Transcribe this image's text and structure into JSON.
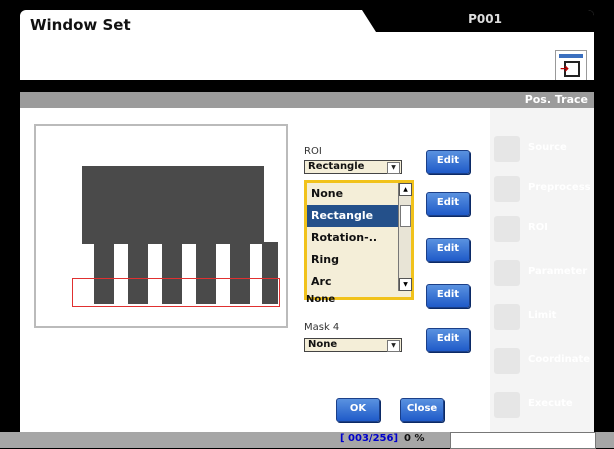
{
  "window": {
    "title": "Window Set",
    "tab": "P001"
  },
  "strip": {
    "label": "Pos. Trace"
  },
  "roi": {
    "label": "ROI",
    "selected": "Rectangle",
    "options": [
      "None",
      "Rectangle",
      "Rotation-..",
      "Ring",
      "Arc"
    ],
    "hidden_value": "None"
  },
  "mask4": {
    "label": "Mask 4",
    "selected": "None"
  },
  "buttons": {
    "edit": "Edit",
    "ok": "OK",
    "close": "Close"
  },
  "nav": {
    "items": [
      {
        "label": "Source",
        "icon": "camera-icon"
      },
      {
        "label": "Preprocess",
        "icon": "preprocess-icon"
      },
      {
        "label": "ROI",
        "icon": "roi-icon"
      },
      {
        "label": "Parameter",
        "icon": "grid-icon"
      },
      {
        "label": "Limit",
        "icon": "limit-icon"
      },
      {
        "label": "Coordinate",
        "icon": "coordinate-icon"
      },
      {
        "label": "Execute",
        "icon": "execute-icon"
      }
    ]
  },
  "status": {
    "counter": "[ 003/256]",
    "percent": "0 %"
  }
}
